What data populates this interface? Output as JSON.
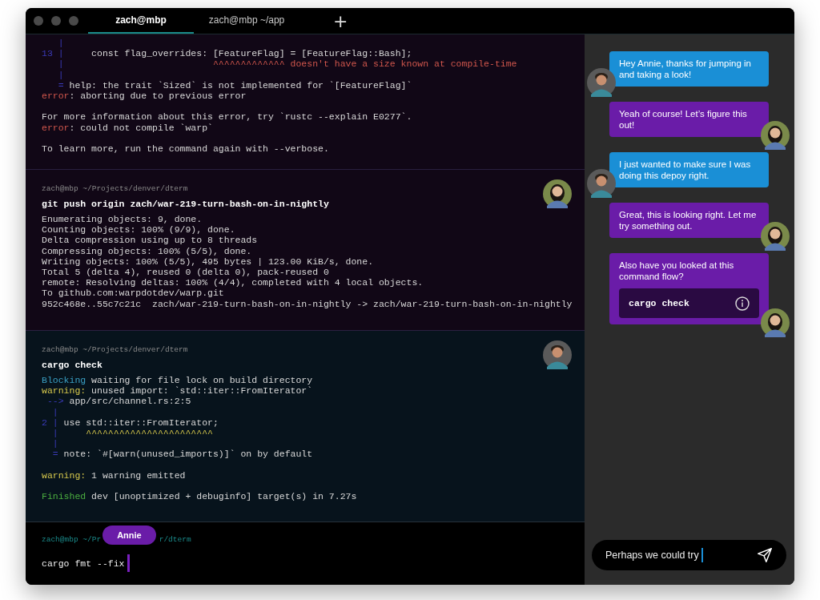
{
  "tabs": [
    {
      "label": "zach@mbp",
      "selected": true
    },
    {
      "label": "zach@mbp ~/app",
      "selected": false
    }
  ],
  "new_tab": "+",
  "blocks": [
    {
      "kind": "output",
      "selected": false,
      "lines": [
        {
          "kind": "text",
          "segments": [
            {
              "text": "   |",
              "kind": "gutter"
            }
          ]
        },
        {
          "kind": "text",
          "segments": [
            {
              "text": "13 |",
              "kind": "gutter"
            },
            {
              "text": "     const flag_overrides: [FeatureFlag] = [FeatureFlag::Bash];",
              "kind": "plain"
            }
          ]
        },
        {
          "kind": "text",
          "segments": [
            {
              "text": "   |",
              "kind": "gutter"
            },
            {
              "text": "                           ^^^^^^^^^^^^^ doesn't have a size known at compile-time",
              "kind": "error"
            }
          ]
        },
        {
          "kind": "text",
          "segments": [
            {
              "text": "   |",
              "kind": "gutter"
            }
          ]
        },
        {
          "kind": "text",
          "segments": [
            {
              "text": "   =",
              "kind": "gutter"
            },
            {
              "text": " help: the trait `Sized` is not implemented for `[FeatureFlag]`",
              "kind": "plain"
            }
          ]
        },
        {
          "kind": "text",
          "segments": [
            {
              "text": "error",
              "kind": "error"
            },
            {
              "text": ": aborting due to previous error",
              "kind": "plain"
            }
          ]
        },
        {
          "kind": "blank"
        },
        {
          "kind": "text",
          "segments": [
            {
              "text": "For more information about this error, try `rustc --explain E0277`.",
              "kind": "plain"
            }
          ]
        },
        {
          "kind": "text",
          "segments": [
            {
              "text": "error",
              "kind": "error"
            },
            {
              "text": ": could not compile `warp`",
              "kind": "plain"
            }
          ]
        },
        {
          "kind": "blank"
        },
        {
          "kind": "text",
          "segments": [
            {
              "text": "To learn more, run the command again with --verbose.",
              "kind": "plain"
            }
          ]
        }
      ]
    },
    {
      "kind": "command",
      "selected": false,
      "prompt": "zach@mbp ~/Projects/denver/dterm",
      "command": "git push origin zach/war-219-turn-bash-on-in-nightly",
      "avatar": {
        "kind": "long_hair"
      },
      "lines": [
        {
          "kind": "text",
          "segments": [
            {
              "text": "Enumerating objects: 9, done.",
              "kind": "plain"
            }
          ]
        },
        {
          "kind": "text",
          "segments": [
            {
              "text": "Counting objects: 100% (9/9), done.",
              "kind": "plain"
            }
          ]
        },
        {
          "kind": "text",
          "segments": [
            {
              "text": "Delta compression using up to 8 threads",
              "kind": "plain"
            }
          ]
        },
        {
          "kind": "text",
          "segments": [
            {
              "text": "Compressing objects: 100% (5/5), done.",
              "kind": "plain"
            }
          ]
        },
        {
          "kind": "text",
          "segments": [
            {
              "text": "Writing objects: 100% (5/5), 495 bytes | 123.00 KiB/s, done.",
              "kind": "plain"
            }
          ]
        },
        {
          "kind": "text",
          "segments": [
            {
              "text": "Total 5 (delta 4), reused 0 (delta 0), pack-reused 0",
              "kind": "plain"
            }
          ]
        },
        {
          "kind": "text",
          "segments": [
            {
              "text": "remote: Resolving deltas: 100% (4/4), completed with 4 local objects.",
              "kind": "plain"
            }
          ]
        },
        {
          "kind": "text",
          "segments": [
            {
              "text": "To github.com:warpdotdev/warp.git",
              "kind": "plain"
            }
          ]
        },
        {
          "kind": "text",
          "segments": [
            {
              "text": "952c468e..55c7c21c  zach/war-219-turn-bash-on-in-nightly -> zach/war-219-turn-bash-on-in-nightly",
              "kind": "plain"
            }
          ]
        }
      ]
    },
    {
      "kind": "command",
      "selected": true,
      "prompt": "zach@mbp ~/Projects/denver/dterm",
      "command": "cargo check",
      "avatar": {
        "kind": "short_hair"
      },
      "lines": [
        {
          "kind": "text",
          "segments": [
            {
              "text": "Blocking",
              "kind": "info"
            },
            {
              "text": " waiting for file lock on build directory",
              "kind": "plain"
            }
          ]
        },
        {
          "kind": "text",
          "segments": [
            {
              "text": "warning:",
              "kind": "warning"
            },
            {
              "text": " unused import: `std::iter::FromIterator`",
              "kind": "plain"
            }
          ]
        },
        {
          "kind": "text",
          "segments": [
            {
              "text": " -->",
              "kind": "gutter"
            },
            {
              "text": " app/src/channel.rs:2:5",
              "kind": "plain"
            }
          ]
        },
        {
          "kind": "text",
          "segments": [
            {
              "text": "  |",
              "kind": "gutter"
            }
          ]
        },
        {
          "kind": "text",
          "segments": [
            {
              "text": "2 |",
              "kind": "gutter"
            },
            {
              "text": " use std::iter::FromIterator;",
              "kind": "plain"
            }
          ]
        },
        {
          "kind": "text",
          "segments": [
            {
              "text": "  |",
              "kind": "gutter"
            },
            {
              "text": "     ^^^^^^^^^^^^^^^^^^^^^^^",
              "kind": "warning"
            }
          ]
        },
        {
          "kind": "text",
          "segments": [
            {
              "text": "  |",
              "kind": "gutter"
            }
          ]
        },
        {
          "kind": "text",
          "segments": [
            {
              "text": "  =",
              "kind": "gutter"
            },
            {
              "text": " note: `#[warn(unused_imports)]` on by default",
              "kind": "plain"
            }
          ]
        },
        {
          "kind": "blank"
        },
        {
          "kind": "text",
          "segments": [
            {
              "text": "warning:",
              "kind": "warning"
            },
            {
              "text": " 1 warning emitted",
              "kind": "plain"
            }
          ]
        },
        {
          "kind": "blank"
        },
        {
          "kind": "text",
          "segments": [
            {
              "text": "Finished",
              "kind": "success"
            },
            {
              "text": " dev [unoptimized + debuginfo] target(s) in 7.27s",
              "kind": "plain"
            }
          ]
        }
      ]
    }
  ],
  "input": {
    "prompt_start": "zach@mbp ~/Pr",
    "badge": "Annie",
    "prompt_end": "r/dterm",
    "value": "cargo fmt --fix"
  },
  "chat": {
    "messages": [
      {
        "kind": "incoming",
        "color": "#1a8fd6",
        "text": "Hey Annie, thanks for jumping in and taking a look!"
      },
      {
        "kind": "outgoing",
        "color": "#6a1ca8",
        "text": "Yeah of course! Let’s figure this out!"
      },
      {
        "kind": "incoming",
        "color": "#1a8fd6",
        "text": "I just wanted to make sure I was doing this depoy right."
      },
      {
        "kind": "outgoing",
        "color": "#6a1ca8",
        "text": "Great, this is looking right. Let me try something out."
      },
      {
        "kind": "outgoing",
        "color": "#6a1ca8",
        "text": "Also have you looked at this command flow?",
        "command": "cargo check"
      }
    ],
    "composer": {
      "value": "Perhaps we could try"
    }
  }
}
